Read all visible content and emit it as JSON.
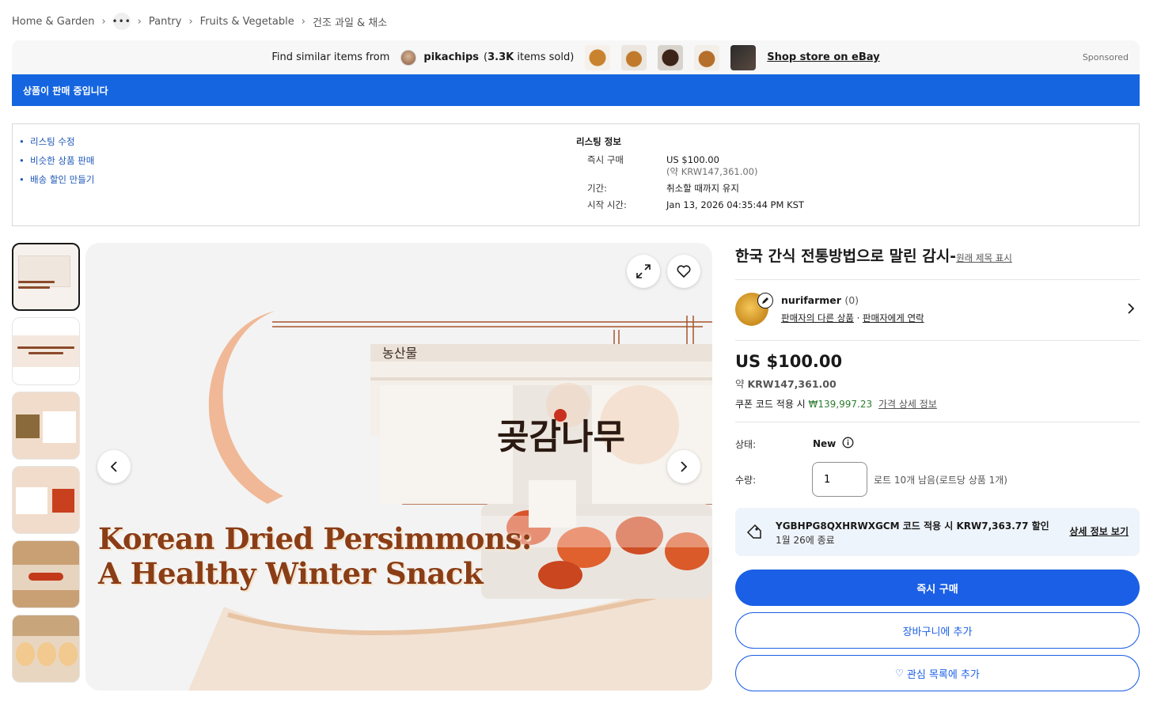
{
  "breadcrumb": {
    "items": [
      "Home & Garden",
      "•••",
      "Pantry",
      "Fruits & Vegetable",
      "건조 과일 & 채소"
    ]
  },
  "similar": {
    "label": "Find similar items from",
    "store_name": "pikachips",
    "sold_prefix": "(",
    "sold_count": "3.3K",
    "sold_suffix": " items sold)",
    "shop_link": "Shop store on eBay",
    "sponsored": "Sponsored"
  },
  "banner": {
    "text": "상품이 판매 중입니다"
  },
  "actions": [
    "리스팅 수정",
    "비슷한 상품 판매",
    "배송 할인 만들기"
  ],
  "listing_info": {
    "title": "리스팅 정보",
    "buy_now_label": "즉시 구매",
    "buy_now_price": "US $100.00",
    "buy_now_approx": "(약 KRW147,361.00)",
    "duration_label": "기간:",
    "duration_value": "취소할 때까지 유지",
    "start_label": "시작 시간:",
    "start_value": "Jan 13, 2026 04:35:44 PM KST"
  },
  "gallery": {
    "hero_line1": "Korean Dried Persimmons:",
    "hero_line2": "A Healthy Winter Snack",
    "brand_mark": "곶감나무",
    "thumb_count": 6
  },
  "item": {
    "title": "한국 간식 전통방법으로 말린 감시-",
    "show_original": "원래 제목 표시",
    "seller_name": "nurifarmer",
    "seller_feedback": "(0)",
    "seller_other": "판매자의 다른 상품",
    "seller_dot": "·",
    "seller_contact": "판매자에게 연락",
    "price": "US $100.00",
    "approx_prefix": "약 ",
    "approx_value": "KRW147,361.00",
    "coupon_prefix": "쿠폰 코드 적용 시 ",
    "coupon_price": "₩139,997.23",
    "price_details": "가격 상세 정보",
    "condition_label": "상태:",
    "condition_value": "New",
    "qty_label": "수량:",
    "qty_value": "1",
    "qty_note": "로트 10개 남음(로트당 상품 1개)",
    "promo_line1": "YGBHPG8QXHRWXGCM 코드 적용 시 KRW7,363.77 할인",
    "promo_line2": "1월 26에 종료",
    "promo_more": "상세 정보 보기",
    "buy_now": "즉시 구매",
    "add_cart": "장바구니에 추가",
    "watchlist": "관심 목록에 추가"
  },
  "colors": {
    "accent": "#1a5fe6",
    "banner": "#1565e0",
    "link": "#1d56b7",
    "green": "#2e7d32"
  }
}
